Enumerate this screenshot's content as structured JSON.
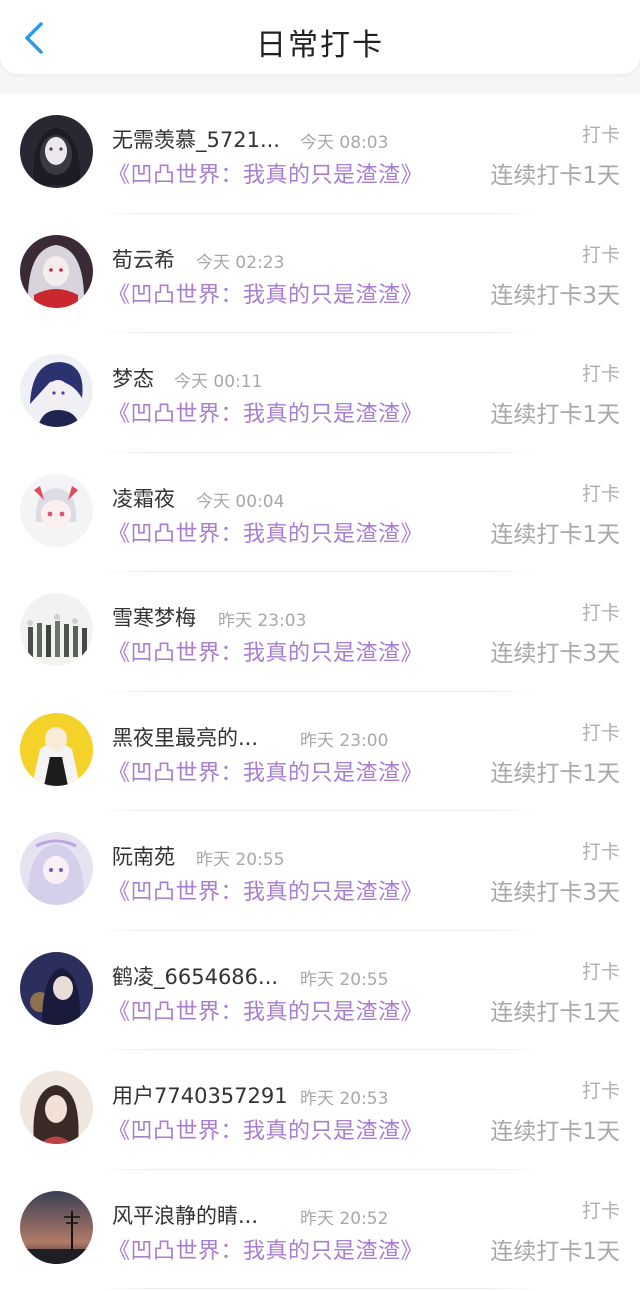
{
  "header": {
    "title": "日常打卡",
    "back_icon": "chevron-left-icon",
    "accent": "#2d9ae8"
  },
  "colors": {
    "book": "#a77ed0",
    "meta": "#a8a8a8"
  },
  "entries": [
    {
      "name": "无需羡慕_5721...",
      "time": "今天 08:03",
      "book": "《凹凸世界：我真的只是渣渣》",
      "tag": "打卡",
      "streak": "连续打卡1天"
    },
    {
      "name": "荀云希",
      "time": "今天 02:23",
      "book": "《凹凸世界：我真的只是渣渣》",
      "tag": "打卡",
      "streak": "连续打卡3天"
    },
    {
      "name": "梦态",
      "time": "今天 00:11",
      "book": "《凹凸世界：我真的只是渣渣》",
      "tag": "打卡",
      "streak": "连续打卡1天"
    },
    {
      "name": "凌霜夜",
      "time": "今天 00:04",
      "book": "《凹凸世界：我真的只是渣渣》",
      "tag": "打卡",
      "streak": "连续打卡1天"
    },
    {
      "name": "雪寒梦梅",
      "time": "昨天 23:03",
      "book": "《凹凸世界：我真的只是渣渣》",
      "tag": "打卡",
      "streak": "连续打卡3天"
    },
    {
      "name": "黑夜里最亮的...",
      "time": "昨天 23:00",
      "book": "《凹凸世界：我真的只是渣渣》",
      "tag": "打卡",
      "streak": "连续打卡1天"
    },
    {
      "name": "阮南苑",
      "time": "昨天 20:55",
      "book": "《凹凸世界：我真的只是渣渣》",
      "tag": "打卡",
      "streak": "连续打卡3天"
    },
    {
      "name": "鹤凌_6654686...",
      "time": "昨天 20:55",
      "book": "《凹凸世界：我真的只是渣渣》",
      "tag": "打卡",
      "streak": "连续打卡1天"
    },
    {
      "name": "用户7740357291",
      "time": "昨天 20:53",
      "book": "《凹凸世界：我真的只是渣渣》",
      "tag": "打卡",
      "streak": "连续打卡1天"
    },
    {
      "name": "风平浪静的睛...",
      "time": "昨天 20:52",
      "book": "《凹凸世界：我真的只是渣渣》",
      "tag": "打卡",
      "streak": "连续打卡1天"
    }
  ]
}
